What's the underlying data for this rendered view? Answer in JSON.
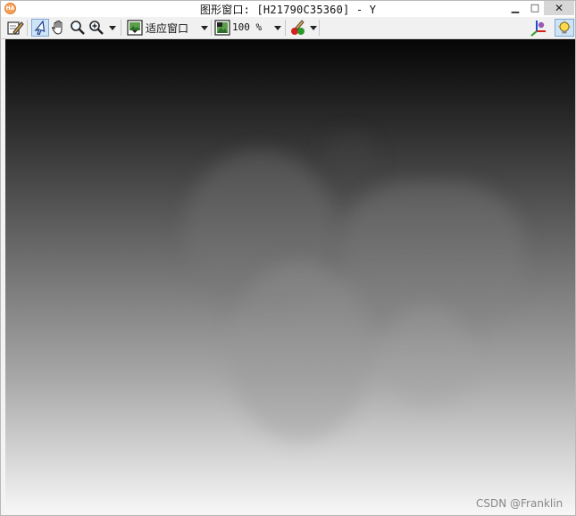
{
  "window": {
    "title": "图形窗口: [H21790C35360] - Y",
    "app_icon_text": "HA",
    "minimize_label": "▁",
    "maximize_label": "□",
    "close_label": "✕"
  },
  "toolbar": {
    "fit_window_label": "适应窗口",
    "zoom_label": "100 %"
  },
  "icons": {
    "edit": "pencil-edit-icon",
    "select": "pointer-arrow-icon",
    "pan": "hand-pan-icon",
    "magnify": "magnifier-icon",
    "zoom": "zoom-in-icon",
    "fit": "fit-window-icon",
    "zoom_image": "zoom-image-icon",
    "color": "color-tools-icon",
    "axes3d": "3d-axes-icon",
    "help": "lightbulb-icon"
  },
  "colors": {
    "selected_tool_bg": "#cfe3f7",
    "selected_tool_border": "#7fa9d6"
  },
  "watermark": "CSDN @Franklin"
}
